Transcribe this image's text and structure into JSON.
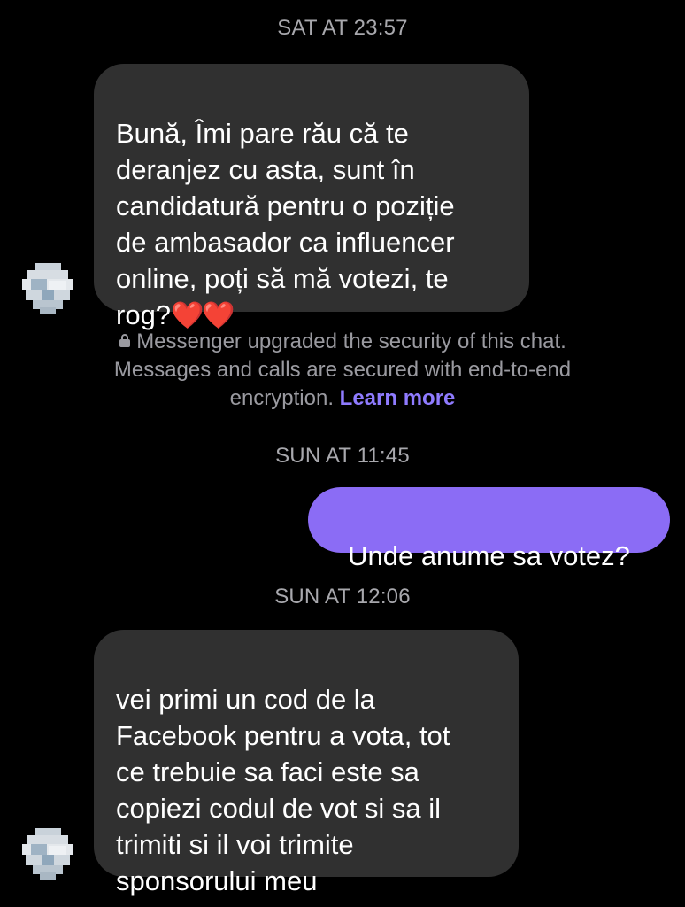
{
  "conversation": {
    "timestamps": {
      "sat": "SAT AT 23:57",
      "sun1": "SUN AT 11:45",
      "sun2": "SUN AT 12:06"
    },
    "messages": [
      {
        "direction": "incoming",
        "text": "Bună, Îmi pare rău că te\nderanjez cu asta, sunt în\ncandidatură pentru o poziție\nde ambasador ca influencer\nonline, poți să mă votezi, te\nrog?",
        "emoji": "❤️❤️"
      },
      {
        "direction": "outgoing",
        "text": "Unde anume sa votez?"
      },
      {
        "direction": "incoming",
        "text": "vei primi un cod de la\nFacebook pentru a vota, tot\nce trebuie sa faci este sa\ncopiezi codul de vot si sa il\ntrimiti si il voi trimite\nsponsorului meu"
      }
    ],
    "security_notice": {
      "icon": "lock-icon",
      "text": "Messenger upgraded the security of this chat. Messages and calls are secured with end-to-end encryption.",
      "link_label": "Learn more"
    }
  },
  "colors": {
    "background": "#000000",
    "incoming_bubble": "#303030",
    "outgoing_bubble": "#8b6cf5",
    "timestamp": "#a8a8ad",
    "link": "#8f7bff"
  }
}
